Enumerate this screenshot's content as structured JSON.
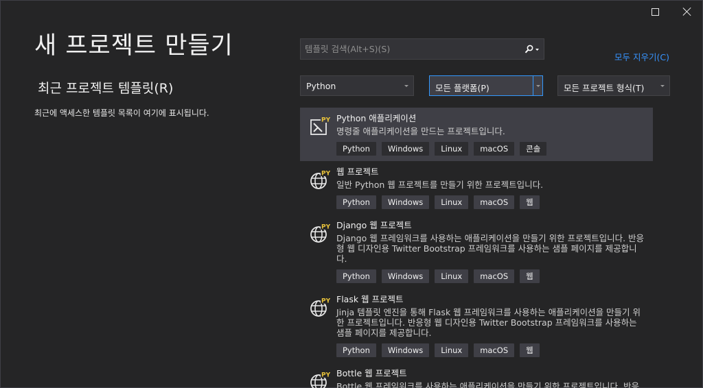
{
  "window": {
    "maximize_label": "",
    "close_label": ""
  },
  "page": {
    "title": "새 프로젝트 만들기"
  },
  "recent": {
    "title": "최근 프로젝트 템플릿(R)",
    "empty_message": "최근에 액세스한 템플릿 목록이 여기에 표시됩니다."
  },
  "search": {
    "placeholder": "템플릿 검색(Alt+S)(S)",
    "value": ""
  },
  "clear_all": "모두 지우기(C)",
  "filters": {
    "language": "Python",
    "platform": "모든 플랫폼(P)",
    "project_type": "모든 프로젝트 형식(T)"
  },
  "templates": [
    {
      "name": "Python 애플리케이션",
      "description": "명령줄 애플리케이션을 만드는 프로젝트입니다.",
      "tags": [
        "Python",
        "Windows",
        "Linux",
        "macOS",
        "콘솔"
      ],
      "icon": "python-console-app-icon",
      "selected": true
    },
    {
      "name": "웹 프로젝트",
      "description": "일반 Python 웹 프로젝트를 만들기 위한 프로젝트입니다.",
      "tags": [
        "Python",
        "Windows",
        "Linux",
        "macOS",
        "웹"
      ],
      "icon": "python-web-globe-icon"
    },
    {
      "name": "Django 웹 프로젝트",
      "description": "Django 웹 프레임워크를 사용하는 애플리케이션을 만들기 위한 프로젝트입니다. 반응형 웹 디자인용 Twitter Bootstrap 프레임워크를 사용하는 샘플 페이지를 제공합니다.",
      "tags": [
        "Python",
        "Windows",
        "Linux",
        "macOS",
        "웹"
      ],
      "icon": "python-web-globe-icon"
    },
    {
      "name": "Flask 웹 프로젝트",
      "description": "Jinja 템플릿 엔진을 통해 Flask 웹 프레임워크를 사용하는 애플리케이션을 만들기 위한 프로젝트입니다. 반응형 웹 디자인용 Twitter Bootstrap 프레임워크를 사용하는 샘플 페이지를 제공합니다.",
      "tags": [
        "Python",
        "Windows",
        "Linux",
        "macOS",
        "웹"
      ],
      "icon": "python-web-globe-icon"
    },
    {
      "name": "Bottle 웹 프로젝트",
      "description": "Bottle 웹 프레임워크를 사용하는 애플리케이션을 만들기 위한 프로젝트입니다. 반응",
      "tags": [],
      "icon": "python-web-globe-icon"
    }
  ],
  "colors": {
    "background": "#252526",
    "accent": "#3794ff",
    "selected_row": "#3f3f46",
    "focus_border": "#3399ff"
  }
}
